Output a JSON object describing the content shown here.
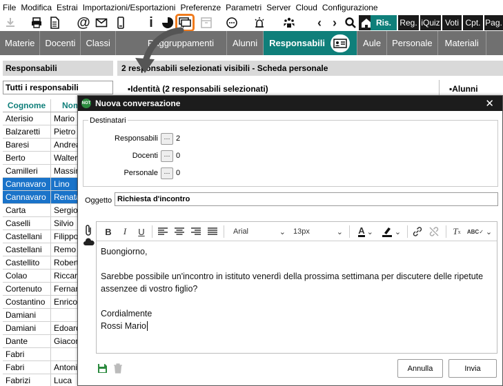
{
  "menu": [
    "File",
    "Modifica",
    "Estrai",
    "Importazioni/Esportazioni",
    "Preferenze",
    "Parametri",
    "Server",
    "Cloud",
    "Configurazione"
  ],
  "toolbar_tabs": [
    {
      "label": "Ris.",
      "active": true
    },
    {
      "label": "Reg.",
      "active": false
    },
    {
      "label": "iQuiz",
      "active": false
    },
    {
      "label": "Voti",
      "active": false
    },
    {
      "label": "Cpt.",
      "active": false
    },
    {
      "label": "Pag.",
      "active": false
    }
  ],
  "nav_tabs": [
    {
      "label": "Materie",
      "active": false
    },
    {
      "label": "Docenti",
      "active": false
    },
    {
      "label": "Classi",
      "active": false
    },
    {
      "label": "Raggruppamenti",
      "active": false
    },
    {
      "label": "Alunni",
      "active": false
    },
    {
      "label": "Responsabili",
      "active": true
    },
    {
      "label": "Aule",
      "active": false
    },
    {
      "label": "Personale",
      "active": false
    },
    {
      "label": "Materiali",
      "active": false
    }
  ],
  "left_panel": {
    "header": "Responsabili",
    "filter": "Tutti i responsabili",
    "columns": [
      "Cognome",
      "Nome"
    ],
    "rows": [
      {
        "cognome": "Aterisio",
        "nome": "Mario",
        "selected": false
      },
      {
        "cognome": "Balzaretti",
        "nome": "Pietro",
        "selected": false
      },
      {
        "cognome": "Baresi",
        "nome": "Andrea",
        "selected": false
      },
      {
        "cognome": "Berto",
        "nome": "Walter",
        "selected": false
      },
      {
        "cognome": "Camilleri",
        "nome": "Massimo",
        "selected": false
      },
      {
        "cognome": "Cannavaro",
        "nome": "Lino",
        "selected": true
      },
      {
        "cognome": "Cannavaro",
        "nome": "Renata",
        "selected": true
      },
      {
        "cognome": "Carta",
        "nome": "Sergio",
        "selected": false
      },
      {
        "cognome": "Caselli",
        "nome": "Silvio",
        "selected": false
      },
      {
        "cognome": "Castellani",
        "nome": "Filippo",
        "selected": false
      },
      {
        "cognome": "Castellani",
        "nome": "Remo",
        "selected": false
      },
      {
        "cognome": "Castellito",
        "nome": "Roberto",
        "selected": false
      },
      {
        "cognome": "Colao",
        "nome": "Riccardo",
        "selected": false
      },
      {
        "cognome": "Cortenuto",
        "nome": "Fernando",
        "selected": false
      },
      {
        "cognome": "Costantino",
        "nome": "Enrico",
        "selected": false
      },
      {
        "cognome": "Damiani",
        "nome": "",
        "selected": false
      },
      {
        "cognome": "Damiani",
        "nome": "Edoardo",
        "selected": false
      },
      {
        "cognome": "Dante",
        "nome": "Giacomo",
        "selected": false
      },
      {
        "cognome": "Fabri",
        "nome": "",
        "selected": false
      },
      {
        "cognome": "Fabri",
        "nome": "Antonio",
        "selected": false
      },
      {
        "cognome": "Fabrizi",
        "nome": "Luca",
        "selected": false
      }
    ]
  },
  "right_panel": {
    "title": "2 responsabili selezionati visibili - Scheda personale",
    "section_left": "Identità (2 responsabili selezionati)",
    "section_right": "Alunni"
  },
  "dialog": {
    "title": "Nuova conversazione",
    "badge": "NOT",
    "recipients_legend": "Destinatari",
    "recipients": [
      {
        "label": "Responsabili",
        "count": "2"
      },
      {
        "label": "Docenti",
        "count": "0"
      },
      {
        "label": "Personale",
        "count": "0"
      }
    ],
    "subject_label": "Oggetto",
    "subject_value": "Richiesta d'incontro",
    "editor": {
      "font": "Arial",
      "size": "13px",
      "body": [
        "Buongiorno,",
        "Sarebbe possibile un'incontro in istituto venerdì della prossima settimana per discutere delle ripetute assenzee di vostro figlio?",
        "Cordialmente",
        "Rossi Mario"
      ]
    },
    "cancel_label": "Annulla",
    "send_label": "Invia"
  },
  "colors": {
    "accent": "#0f7f7a",
    "highlight": "#f07b1d",
    "selection": "#1a73c9",
    "nav_bg": "#707070"
  }
}
